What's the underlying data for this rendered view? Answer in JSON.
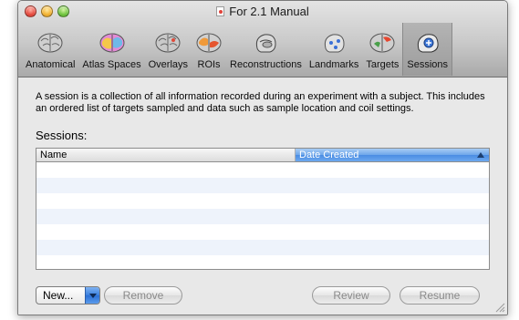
{
  "window": {
    "title": "For 2.1 Manual"
  },
  "toolbar": {
    "items": [
      {
        "label": "Anatomical",
        "icon": "brain-gray-icon"
      },
      {
        "label": "Atlas Spaces",
        "icon": "brain-colored-icon"
      },
      {
        "label": "Overlays",
        "icon": "brain-gray-icon"
      },
      {
        "label": "ROIs",
        "icon": "brain-roi-icon"
      },
      {
        "label": "Reconstructions",
        "icon": "head-reconstruction-icon"
      },
      {
        "label": "Landmarks",
        "icon": "head-landmarks-icon"
      },
      {
        "label": "Targets",
        "icon": "brain-targets-icon"
      },
      {
        "label": "Sessions",
        "icon": "sessions-icon"
      }
    ],
    "selected": "Sessions"
  },
  "description": "A session is a collection of all information recorded during an experiment with a subject. This includes an ordered list of targets sampled and data such as sample location and coil settings.",
  "sessions_label": "Sessions:",
  "table": {
    "columns": [
      "Name",
      "Date Created"
    ],
    "sorted_column": "Date Created",
    "rows": []
  },
  "buttons": {
    "new": "New...",
    "remove": "Remove",
    "review": "Review",
    "resume": "Resume"
  }
}
